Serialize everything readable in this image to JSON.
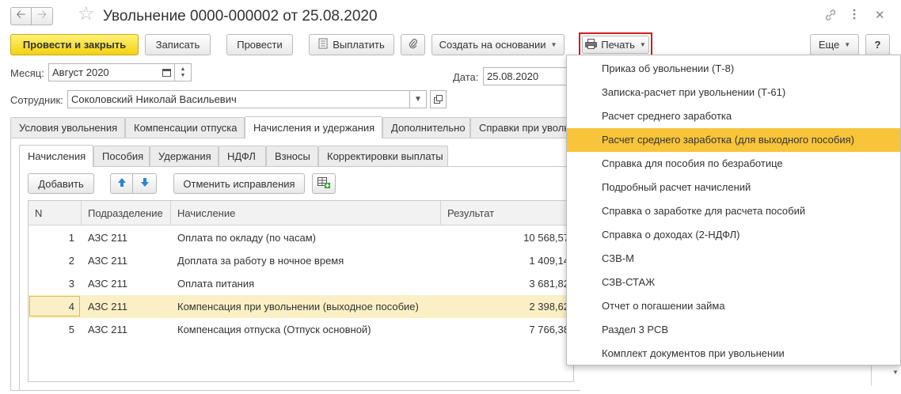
{
  "window": {
    "title": "Увольнение 0000-000002 от 25.08.2020",
    "back_icon": "arrow-left-icon",
    "forward_icon": "arrow-right-icon",
    "favorite_icon": "star-icon",
    "link_icon": "link-icon",
    "more_icon": "more-vert-icon",
    "close_icon": "close-icon"
  },
  "toolbar": {
    "post_and_close": "Провести и закрыть",
    "save": "Записать",
    "post": "Провести",
    "pay": "Выплатить",
    "create_based_on": "Создать на основании",
    "print": "Печать",
    "more": "Еще",
    "help": "?"
  },
  "form": {
    "month_label": "Месяц:",
    "month_value": "Август 2020",
    "date_label": "Дата:",
    "date_value": "25.08.2020",
    "employee_label": "Сотрудник:",
    "employee_value": "Соколовский Николай Васильевич"
  },
  "tabs": [
    "Условия увольнения",
    "Компенсации отпуска",
    "Начисления и удержания",
    "Дополнительно",
    "Справки при уволь"
  ],
  "subtabs": [
    "Начисления",
    "Пособия",
    "Удержания",
    "НДФЛ",
    "Взносы",
    "Корректировки выплаты"
  ],
  "grid_toolbar": {
    "add": "Добавить",
    "cancel_corrections": "Отменить исправления"
  },
  "table": {
    "columns": [
      "N",
      "Подразделение",
      "Начисление",
      "Результат"
    ],
    "rows": [
      {
        "n": "1",
        "dept": "АЗС 211",
        "accrual": "Оплата по окладу (по часам)",
        "result": "10 568,57"
      },
      {
        "n": "2",
        "dept": "АЗС 211",
        "accrual": "Доплата за работу в ночное время",
        "result": "1 409,14"
      },
      {
        "n": "3",
        "dept": "АЗС 211",
        "accrual": "Оплата питания",
        "result": "3 681,82"
      },
      {
        "n": "4",
        "dept": "АЗС 211",
        "accrual": "Компенсация при увольнении (выходное пособие)",
        "result": "2 398,62"
      },
      {
        "n": "5",
        "dept": "АЗС 211",
        "accrual": "Компенсация отпуска (Отпуск основной)",
        "result": "7 766,38"
      }
    ]
  },
  "print_menu": {
    "items": [
      "Приказ об увольнении (Т-8)",
      "Записка-расчет при увольнении (Т-61)",
      "Расчет среднего заработка",
      "Расчет среднего заработка (для выходного пособия)",
      "Справка для пособия по безработице",
      "Подробный расчет начислений",
      "Справка о заработке для расчета пособий",
      "Справка о доходах (2-НДФЛ)",
      "СЗВ-М",
      "СЗВ-СТАЖ",
      "Отчет о погашении займа",
      "Раздел 3 РСВ",
      "Комплект документов при увольнении"
    ]
  },
  "colors": {
    "primary_button": "#f4d110",
    "menu_highlight": "#f7c43a",
    "selected_row": "#fbf0c5",
    "print_frame": "#d9191c"
  }
}
